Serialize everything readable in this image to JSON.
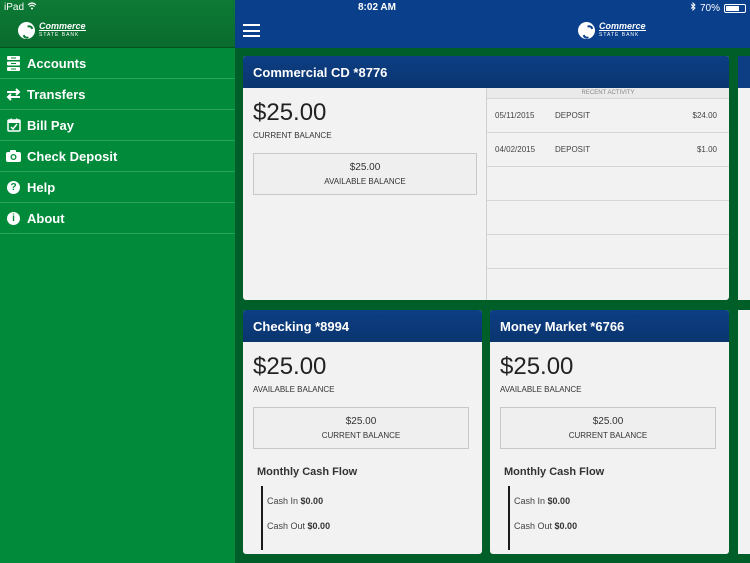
{
  "status_bar": {
    "device": "iPad",
    "time": "8:02 AM",
    "battery": "70%",
    "battery_level": 0.7
  },
  "brand": {
    "name": "Commerce",
    "sub": "STATE BANK"
  },
  "menu": [
    {
      "label": "Accounts",
      "icon": "accounts-icon"
    },
    {
      "label": "Transfers",
      "icon": "transfers-icon"
    },
    {
      "label": "Bill Pay",
      "icon": "bill-pay-icon"
    },
    {
      "label": "Check Deposit",
      "icon": "camera-icon"
    },
    {
      "label": "Help",
      "icon": "help-icon"
    },
    {
      "label": "About",
      "icon": "info-icon"
    }
  ],
  "accounts": {
    "cd": {
      "title": "Commercial CD *8776",
      "balance": "$25.00",
      "balance_label": "CURRENT BALANCE",
      "secondary_amount": "$25.00",
      "secondary_label": "AVAILABLE BALANCE",
      "activity_header": "RECENT ACTIVITY",
      "activity": [
        {
          "date": "05/11/2015",
          "type": "DEPOSIT",
          "amount": "$24.00"
        },
        {
          "date": "04/02/2015",
          "type": "DEPOSIT",
          "amount": "$1.00"
        }
      ]
    },
    "checking": {
      "title": "Checking *8994",
      "balance": "$25.00",
      "balance_label": "AVAILABLE BALANCE",
      "secondary_amount": "$25.00",
      "secondary_label": "CURRENT BALANCE",
      "cashflow_title": "Monthly Cash Flow",
      "cash_in_label": "Cash In",
      "cash_in": "$0.00",
      "cash_out_label": "Cash Out",
      "cash_out": "$0.00"
    },
    "money_market": {
      "title": "Money Market *6766",
      "balance": "$25.00",
      "balance_label": "AVAILABLE BALANCE",
      "secondary_amount": "$25.00",
      "secondary_label": "CURRENT BALANCE",
      "cashflow_title": "Monthly Cash Flow",
      "cash_in_label": "Cash In",
      "cash_in": "$0.00",
      "cash_out_label": "Cash Out",
      "cash_out": "$0.00"
    }
  }
}
